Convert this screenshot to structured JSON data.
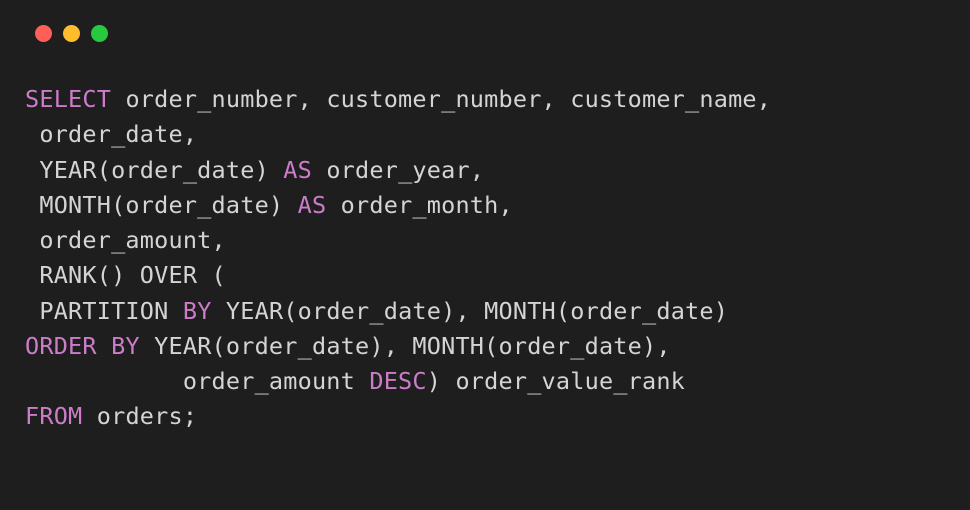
{
  "windowControls": {
    "red": "close",
    "yellow": "minimize",
    "green": "maximize"
  },
  "code": {
    "line1": {
      "select": "SELECT",
      "rest": " order_number, customer_number, customer_name,"
    },
    "line2": " order_date,",
    "line3": {
      "pre": " YEAR(order_date) ",
      "as": "AS",
      "post": " order_year,"
    },
    "line4": {
      "pre": " MONTH(order_date) ",
      "as": "AS",
      "post": " order_month,"
    },
    "line5": " order_amount,",
    "line6": " RANK() OVER (",
    "line7": {
      "pre": " PARTITION ",
      "by": "BY",
      "post": " YEAR(order_date), MONTH(order_date)"
    },
    "line8": {
      "orderby": "ORDER BY",
      "post": " YEAR(order_date), MONTH(order_date),"
    },
    "line9": {
      "pre": "           order_amount ",
      "desc": "DESC",
      "post": ") order_value_rank"
    },
    "line10": {
      "from": "FROM",
      "post": " orders;"
    }
  }
}
